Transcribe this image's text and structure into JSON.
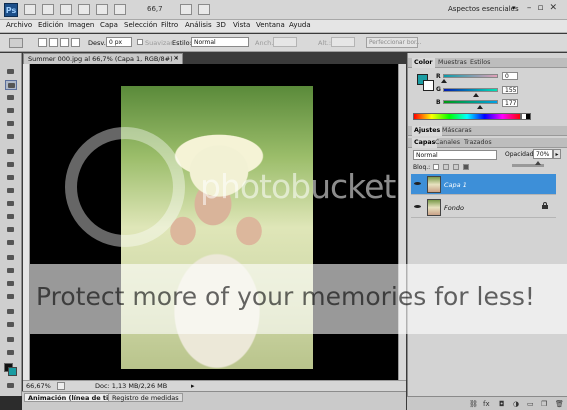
{
  "app": {
    "logo": "Ps",
    "zoom_value": "66,7",
    "workspace": "Aspectos esenciales"
  },
  "menu": [
    "Archivo",
    "Edición",
    "Imagen",
    "Capa",
    "Selección",
    "Filtro",
    "Análisis",
    "3D",
    "Vista",
    "Ventana",
    "Ayuda"
  ],
  "options": {
    "feather_label": "Desv.:",
    "feather_value": "0 px",
    "antialias_label": "Suavizar",
    "style_label": "Estilo:",
    "style_value": "Normal",
    "width_label": "Anch.:",
    "height_label": "Alt.:",
    "refine_label": "Perfeccionar bor..."
  },
  "document": {
    "tab_label": "Summer 000.jpg al 66,7% (Capa 1, RGB/8#) *",
    "zoom": "66,67%",
    "info": "Doc: 1,13 MB/2,26 MB"
  },
  "bottom_tabs": [
    "Animación (línea de tiempo)",
    "Registro de medidas"
  ],
  "color_panel": {
    "tabs": [
      "Color",
      "Muestras",
      "Estilos"
    ],
    "fg_color": "#1a9ca2",
    "r_label": "R",
    "g_label": "G",
    "b_label": "B",
    "r_value": "0",
    "g_value": "155",
    "b_value": "177"
  },
  "adjust_panel": {
    "tabs": [
      "Ajustes",
      "Máscaras"
    ]
  },
  "layers_panel": {
    "tabs": [
      "Capas",
      "Canales",
      "Trazados"
    ],
    "blend_mode": "Normal",
    "opacity_label": "Opacidad:",
    "opacity_value": "70%",
    "lock_label": "Bloq.:",
    "layers": [
      {
        "name": "Capa 1",
        "selected": true,
        "locked": false
      },
      {
        "name": "Fondo",
        "selected": false,
        "locked": true
      }
    ]
  },
  "watermark": {
    "logo_text": "photobucket",
    "band_text": "Protect more of your memories for less!"
  }
}
